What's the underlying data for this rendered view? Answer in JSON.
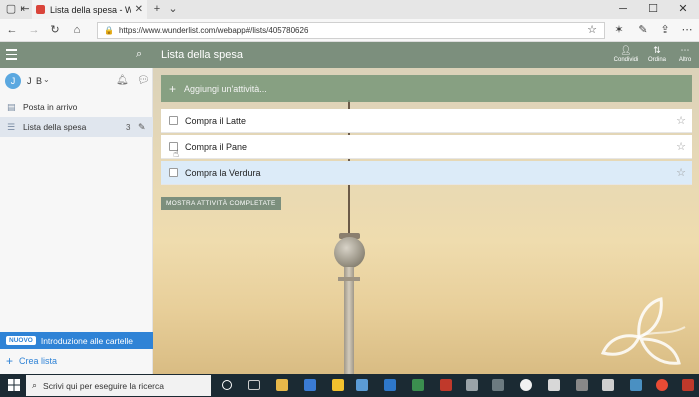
{
  "browser": {
    "tab_title": "Lista della spesa - Wund",
    "url": "https://www.wunderlist.com/webapp#/lists/405780626"
  },
  "sidebar": {
    "user_initial": "J",
    "user_name": "J B",
    "items": [
      {
        "label": "Posta in arrivo",
        "count": ""
      },
      {
        "label": "Lista della spesa",
        "count": "3"
      }
    ],
    "banner_badge": "NUOVO",
    "banner_text": "Introduzione alle cartelle",
    "create_list": "Crea lista"
  },
  "main": {
    "title": "Lista della spesa",
    "actions": [
      {
        "label": "Condividi",
        "icon": "share-icon"
      },
      {
        "label": "Ordina",
        "icon": "sort-icon"
      },
      {
        "label": "Altro",
        "icon": "more-icon"
      }
    ],
    "add_placeholder": "Aggiungi un'attività...",
    "tasks": [
      {
        "title": "Compra il Latte"
      },
      {
        "title": "Compra il Pane"
      },
      {
        "title": "Compra la Verdura"
      }
    ],
    "show_completed": "MOSTRA ATTIVITÀ COMPLETATE"
  },
  "taskbar": {
    "search_placeholder": "Scrivi qui per eseguire la ricerca"
  },
  "colors": {
    "header_green": "#7c8f7d",
    "accent_blue": "#2f83d6",
    "selected_row": "#dcebf8"
  }
}
